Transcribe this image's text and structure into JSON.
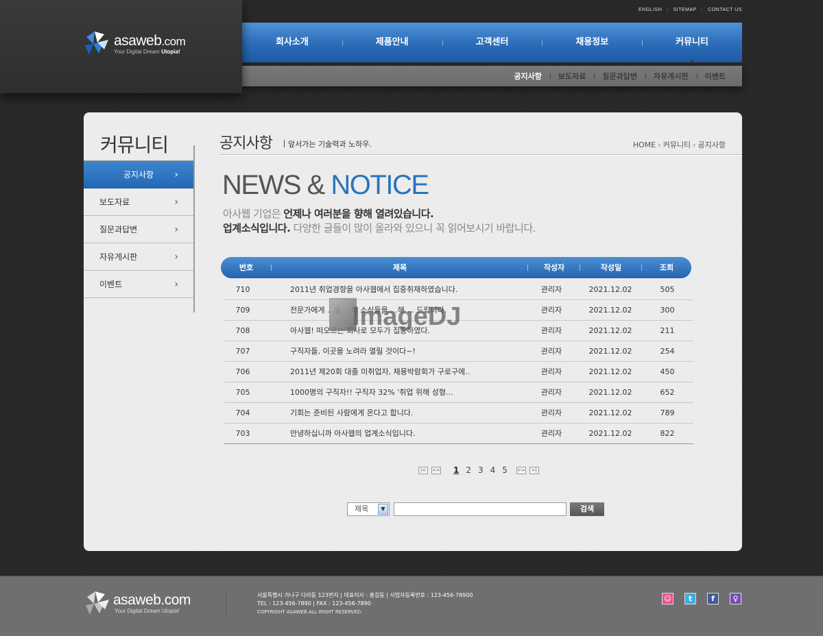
{
  "brand": {
    "name_main": "asaweb",
    "name_suffix": ".com",
    "tagline_prefix": "Your Digital Dream ",
    "tagline_bold": "Utopia!"
  },
  "util_links": [
    "ENGLISH",
    "SITEMAP",
    "CONTACT US"
  ],
  "gnb": {
    "items": [
      "회사소개",
      "제품안내",
      "고객센터",
      "채용정보",
      "커뮤니티"
    ],
    "active_index": 4
  },
  "lnb": {
    "items": [
      "공지사항",
      "보도자료",
      "질문과답변",
      "자유게시판",
      "이벤트"
    ],
    "active_index": 0
  },
  "sidebar": {
    "title": "커뮤니티",
    "items": [
      "공지사항",
      "보도자료",
      "질문과답변",
      "자유게시판",
      "이벤트"
    ],
    "active_index": 0
  },
  "page": {
    "title": "공지사항",
    "description": "앞서가는 기술력과 노하우.",
    "breadcrumb": [
      "HOME",
      "커뮤니티",
      "공지사항"
    ],
    "hero_gray": "NEWS & ",
    "hero_blue": "NOTICE",
    "intro_line1_light": "아사웹 기업은 ",
    "intro_line1_bold": "언제나 여러분을 향해 열려있습니다.",
    "intro_line2_bold": "업계소식입니다.",
    "intro_line2_light": " 다양한 글들이 많이 올라와 있으니 꼭 읽어보시기 바랍니다."
  },
  "table": {
    "headers": [
      "번호",
      "제목",
      "작성자",
      "작성일",
      "조회"
    ],
    "rows": [
      {
        "no": "710",
        "title": "2011년 취업경향을 아사웹에서 집중취재하였습니다.",
        "author": "관리자",
        "date": "2021.12.02",
        "views": "505"
      },
      {
        "no": "709",
        "title": "전문가에게 ...들 ...의 소식들을 ...해 ... 드립니다.",
        "author": "관리자",
        "date": "2021.12.02",
        "views": "300"
      },
      {
        "no": "708",
        "title": "아사웹! 떠오르는 회사로 모두가 집중하였다.",
        "author": "관리자",
        "date": "2021.12.02",
        "views": "211"
      },
      {
        "no": "707",
        "title": "구직자들, 이곳을 노려라 열릴 것이다~!",
        "author": "관리자",
        "date": "2021.12.02",
        "views": "254"
      },
      {
        "no": "706",
        "title": "2011년 제20회 대졸 미취업자, 채용박람회가 구로구에..",
        "author": "관리자",
        "date": "2021.12.02",
        "views": "450"
      },
      {
        "no": "705",
        "title": "1000명의 구직자!! 구직자 32% '취업 위해 성형...",
        "author": "관리자",
        "date": "2021.12.02",
        "views": "652"
      },
      {
        "no": "704",
        "title": "기회는 준비된 사람에게 온다고 합니다.",
        "author": "관리자",
        "date": "2021.12.02",
        "views": "789"
      },
      {
        "no": "703",
        "title": "안녕하십니까 아사웹의 업계소식입니다.",
        "author": "관리자",
        "date": "2021.12.02",
        "views": "822"
      }
    ]
  },
  "paging": {
    "pages": [
      "1",
      "2",
      "3",
      "4",
      "5"
    ],
    "current": "1",
    "first": "|<",
    "prev": "<<",
    "next": ">>",
    "last": ">|"
  },
  "search": {
    "field_selected": "제목",
    "query": "",
    "button_label": "검색"
  },
  "watermark": "ImageDJ",
  "footer": {
    "address_line": "서울특별시 가나구 다라동 123번지  |  대표이사 : 홍길동  |  사업자등록번호 : 123-456-78900",
    "contact_line": "TEL : 123-456-7890  |  FAX : 123-456-7890",
    "copyright": "COPYRIGHT ASAWEB ALL RIGHT RESERVED.",
    "brand_name": "asaweb.com",
    "brand_tagline": "Your Digital Dream Utopia!"
  },
  "social": [
    {
      "name": "cyworld",
      "glyph": "☺",
      "color": "#e8508a"
    },
    {
      "name": "twitter",
      "glyph": "t",
      "color": "#3ab0e8"
    },
    {
      "name": "facebook",
      "glyph": "f",
      "color": "#3b5b9a"
    },
    {
      "name": "me2day",
      "glyph": "♀",
      "color": "#7b4bb2"
    }
  ],
  "colors": {
    "accent_blue": "#2a73bf",
    "nav_blue": "#2e6fbb",
    "footer_gray": "#6f6f6f"
  }
}
